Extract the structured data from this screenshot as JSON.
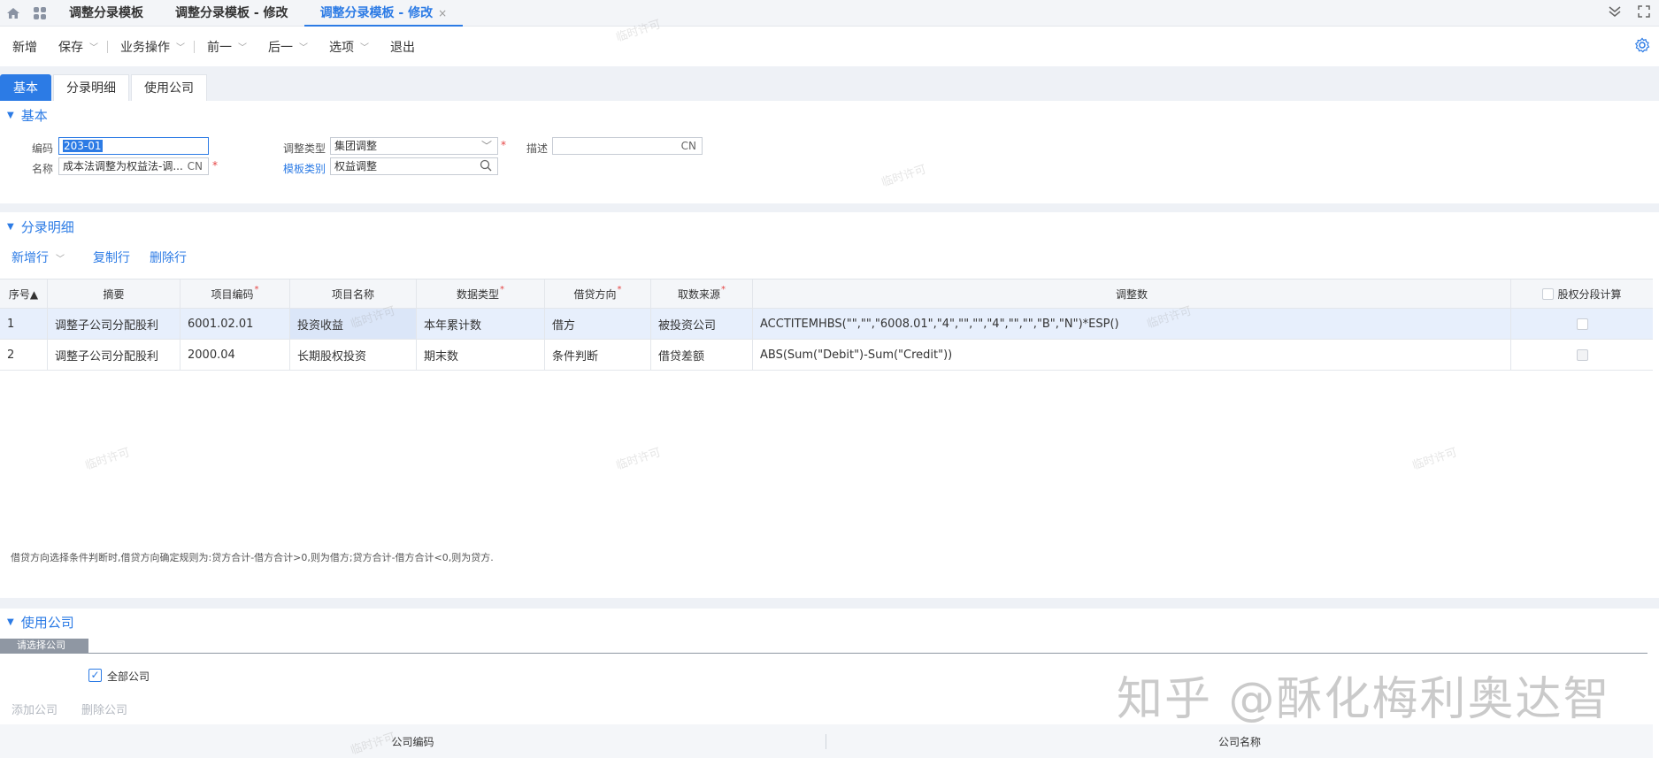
{
  "window_tabs": [
    {
      "label": "调整分录模板"
    },
    {
      "label": "调整分录模板 - 修改"
    },
    {
      "label": "调整分录模板 - 修改",
      "close": "×"
    }
  ],
  "toolbar": {
    "new": "新增",
    "save": "保存",
    "business": "业务操作",
    "prev": "前一",
    "next": "后一",
    "options": "选项",
    "exit": "退出"
  },
  "form_tabs": [
    "基本",
    "分录明细",
    "使用公司"
  ],
  "basic": {
    "section_title": "基本",
    "code_label": "编码",
    "code_value": "203-01",
    "name_label": "名称",
    "name_value": "成本法调整为权益法-调...",
    "name_suffix": "CN",
    "type_label": "调整类型",
    "type_value": "集团调整",
    "category_label": "模板类别",
    "category_value": "权益调整",
    "desc_label": "描述",
    "desc_suffix": "CN"
  },
  "detail": {
    "section_title": "分录明细",
    "add_row": "新增行",
    "copy_row": "复制行",
    "delete_row": "删除行",
    "columns": [
      "序号▲",
      "摘要",
      "项目编码",
      "项目名称",
      "数据类型",
      "借贷方向",
      "取数来源",
      "调整数",
      "股权分段计算"
    ],
    "rows": [
      [
        "1",
        "调整子公司分配股利",
        "6001.02.01",
        "投资收益",
        "本年累计数",
        "借方",
        "被投资公司",
        "ACCTITEMHBS(\"\",\"\",\"6008.01\",\"4\",\"\",\"\",\"4\",\"\",\"\",\"B\",\"N\")*ESP()"
      ],
      [
        "2",
        "调整子公司分配股利",
        "2000.04",
        "长期股权投资",
        "期末数",
        "条件判断",
        "借贷差额",
        "ABS(Sum(\"Debit\")-Sum(\"Credit\"))"
      ]
    ],
    "note": "借贷方向选择条件判断时,借贷方向确定规则为:贷方合计-借方合计>0,则为借方;贷方合计-借方合计<0,则为贷方."
  },
  "company": {
    "section_title": "使用公司",
    "subtab": "请选择公司",
    "all_companies": "全部公司",
    "add_company": "添加公司",
    "delete_company": "删除公司",
    "col_code": "公司编码",
    "col_name": "公司名称"
  },
  "watermark": "临时许可",
  "corner_watermark": "知乎 @酥化梅利奥达智"
}
